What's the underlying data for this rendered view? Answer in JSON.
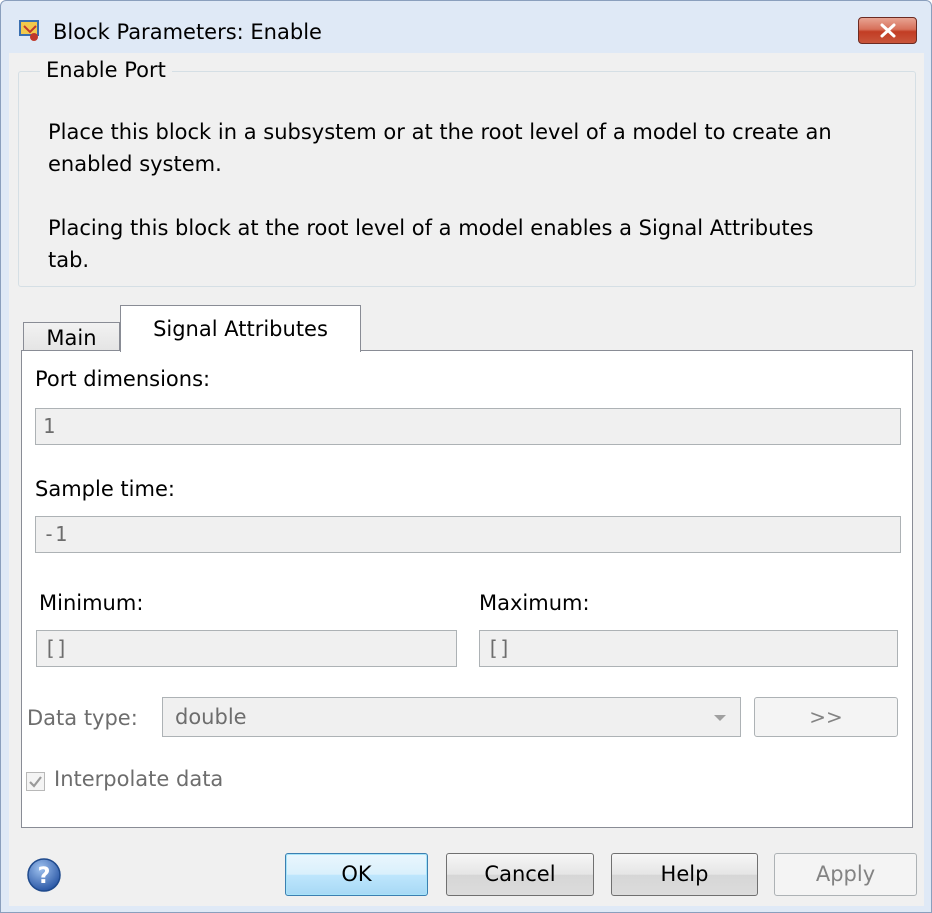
{
  "window": {
    "title": "Block Parameters: Enable"
  },
  "groupbox": {
    "legend": "Enable Port",
    "description_1_line_1": "Place this block in a subsystem or at the root level of a model to create an",
    "description_1_line_2": "enabled system.",
    "description_2_line_1": "Placing this block at the root level of a model enables a Signal Attributes",
    "description_2_line_2": "tab."
  },
  "tabs": [
    {
      "label": "Main",
      "selected": false
    },
    {
      "label": "Signal Attributes",
      "selected": true
    }
  ],
  "signal_attributes": {
    "port_dimensions_label": "Port dimensions:",
    "port_dimensions_value": "1",
    "sample_time_label": "Sample time:",
    "sample_time_value": "-1",
    "minimum_label": "Minimum:",
    "minimum_value": "[]",
    "maximum_label": "Maximum:",
    "maximum_value": "[]",
    "data_type_label": "Data type:",
    "data_type_value": "double",
    "data_type_assistant_label": ">>",
    "interpolate_label": "Interpolate data",
    "interpolate_checked": true
  },
  "buttons": {
    "ok": "OK",
    "cancel": "Cancel",
    "help": "Help",
    "apply": "Apply"
  },
  "icons": {
    "app": "simulink-block-icon",
    "close": "close-icon",
    "help": "help-icon",
    "dropdown": "chevron-down-icon",
    "check": "check-icon"
  },
  "colors": {
    "window_frame": "#dfe9f6",
    "client_bg": "#f0f0f0",
    "close_button": "#c9553b",
    "ok_button": "#bee6fd",
    "disabled_text": "#6d6d6d"
  }
}
